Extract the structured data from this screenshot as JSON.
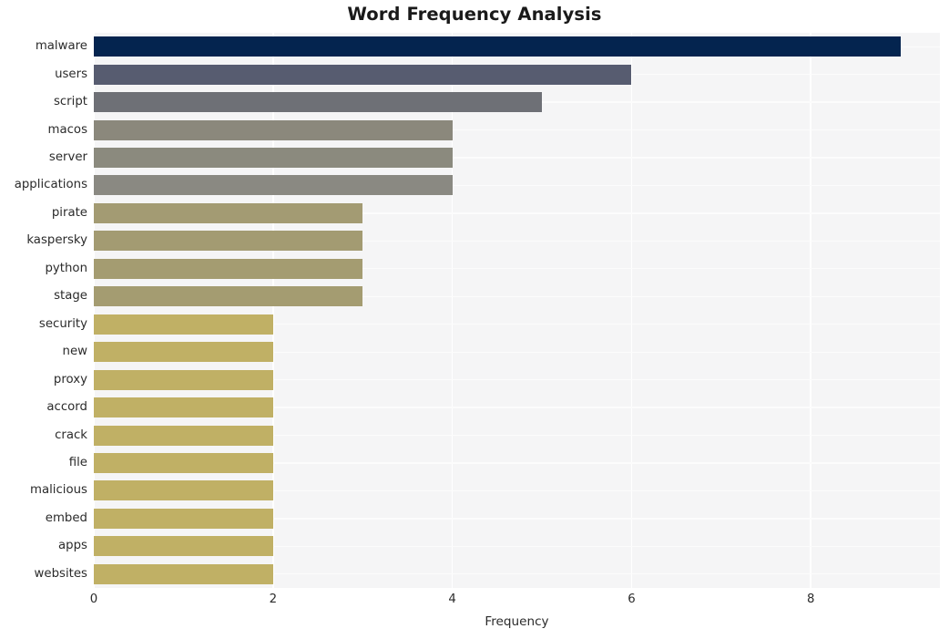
{
  "chart_data": {
    "type": "bar",
    "orientation": "horizontal",
    "title": "Word Frequency Analysis",
    "xlabel": "Frequency",
    "ylabel": "",
    "categories": [
      "malware",
      "users",
      "script",
      "macos",
      "server",
      "applications",
      "pirate",
      "kaspersky",
      "python",
      "stage",
      "security",
      "new",
      "proxy",
      "accord",
      "crack",
      "file",
      "malicious",
      "embed",
      "apps",
      "websites"
    ],
    "values": [
      9,
      6,
      5,
      4,
      4,
      4,
      3,
      3,
      3,
      3,
      2,
      2,
      2,
      2,
      2,
      2,
      2,
      2,
      2,
      2
    ],
    "bar_colors": [
      "#04244f",
      "#575c70",
      "#6e7076",
      "#8b887c",
      "#8b8a7e",
      "#8a8982",
      "#a39b73",
      "#a39b72",
      "#a49c71",
      "#a49c71",
      "#c0b065",
      "#c0b065",
      "#c0b065",
      "#c0b065",
      "#c0b065",
      "#c0b065",
      "#c0b065",
      "#c0b065",
      "#c0b065",
      "#c0b065"
    ],
    "xlim": [
      0,
      9.44
    ],
    "xticks": [
      0,
      2,
      4,
      6,
      8
    ],
    "xtick_labels": [
      "0",
      "2",
      "4",
      "6",
      "8"
    ],
    "grid": true,
    "grid_color": "#ffffff",
    "plot_background": "#f5f5f6",
    "figure_background": "#ffffff",
    "legend": null
  }
}
